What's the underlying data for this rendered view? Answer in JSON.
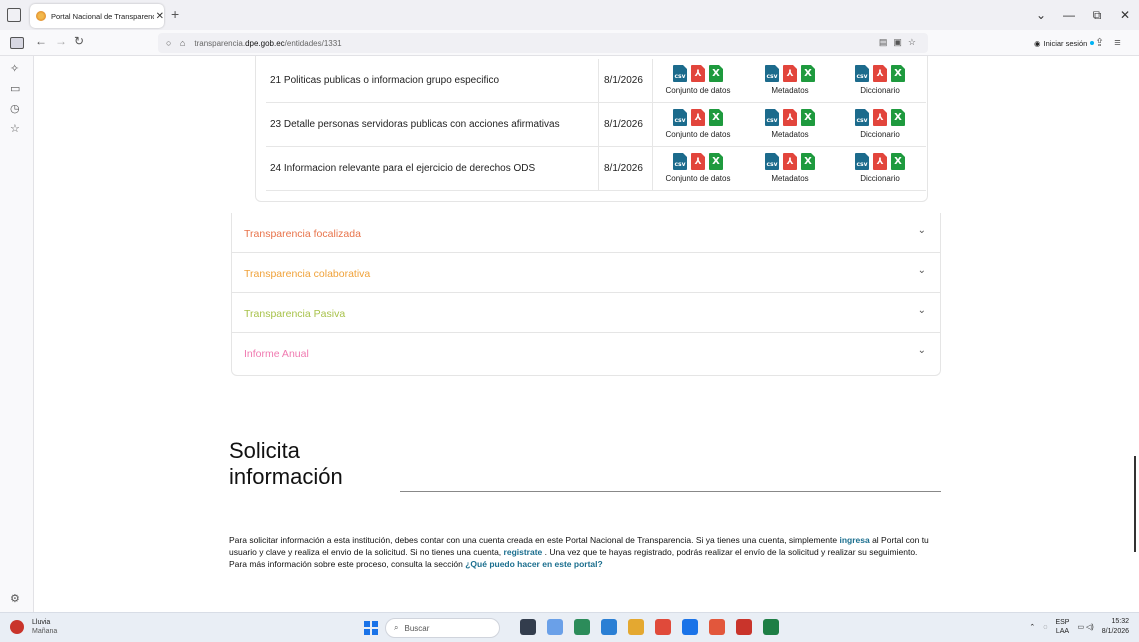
{
  "browser": {
    "tab_title": "Portal Nacional de Transparenc",
    "tab_close": "✕",
    "new_tab": "+",
    "url_prefix": "transparencia.",
    "url_host": "dpe.gob.ec",
    "url_path": "/entidades/1331",
    "login_label": "Iniciar sesión",
    "window_controls": [
      "⌄",
      "—",
      "⧉",
      "✕"
    ]
  },
  "table": {
    "rows": [
      {
        "name": "21 Politicas publicas o informacion grupo especifico",
        "date": "8/1/2026"
      },
      {
        "name": "23 Detalle personas servidoras publicas con acciones afirmativas",
        "date": "8/1/2026"
      },
      {
        "name": "24 Informacion relevante para el ejercicio de derechos ODS",
        "date": "8/1/2026"
      }
    ],
    "labels": {
      "datos": "Conjunto de datos",
      "metadatos": "Metadatos",
      "diccionario": "Diccionario"
    },
    "icon_texts": {
      "csv": "csv",
      "pdf": "⅄",
      "xls": "X"
    }
  },
  "accordion": [
    {
      "title": "Transparencia focalizada",
      "color": "#e8734a"
    },
    {
      "title": "Transparencia colaborativa",
      "color": "#f0a23a"
    },
    {
      "title": "Transparencia Pasiva",
      "color": "#a8c24a"
    },
    {
      "title": "Informe Anual",
      "color": "#f07ab0"
    }
  ],
  "solicita": {
    "title_line1": "Solicita",
    "title_line2": "información",
    "p1_a": "Para solicitar información a esta institución, debes contar con una cuenta creada en este Portal Nacional de Transparencia. Si ya tienes una cuenta, simplemente ",
    "link_ingresa": "ingresa",
    "p1_b": " al Portal con tu usuario y clave y realiza el envio de la solicitud. Si no tienes una cuenta, ",
    "link_registrate": "registrate",
    "p1_c": " . Una vez que te hayas registrado, podrás realizar el envío de la solicitud y realizar su seguimiento.",
    "p2_a": "Para más información sobre este proceso, consulta la sección ",
    "link_que": "¿Qué puedo hacer en este portal?"
  },
  "taskbar": {
    "weather_label": "Lluvia",
    "weather_sub": "Mañana",
    "search_placeholder": "Buscar",
    "lang_top": "ESP",
    "lang_bottom": "LAA",
    "time": "15:32",
    "date": "8/1/2026",
    "app_colors": [
      "#333d4d",
      "#6aa0e8",
      "#2c8c5a",
      "#2a7fd4",
      "#e4a830",
      "#e04a3a",
      "#1a73e8",
      "#e2573c",
      "#c9342b",
      "#1e7e45"
    ]
  }
}
